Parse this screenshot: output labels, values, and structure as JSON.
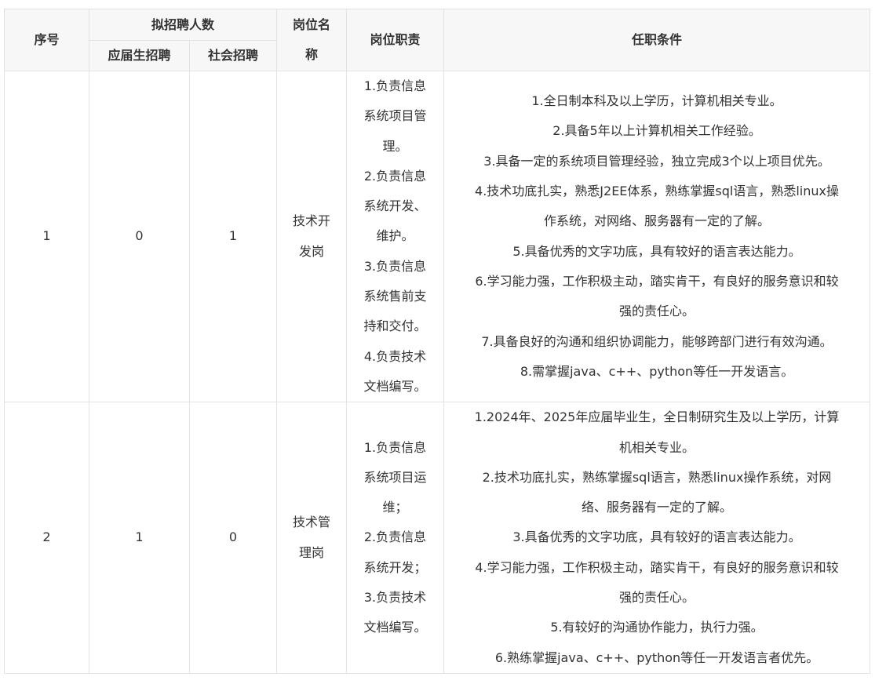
{
  "headers": {
    "seq": "序号",
    "plan_count": "拟招聘人数",
    "fresh": "应届生招聘",
    "social": "社会招聘",
    "position_name_lines": [
      "岗位名",
      "称"
    ],
    "duties": "岗位职责",
    "requirements": "任职条件"
  },
  "rows": [
    {
      "seq": "1",
      "fresh": "0",
      "social": "1",
      "position_lines": [
        "技术开",
        "发岗"
      ],
      "duties_lines": [
        "1.负责信息",
        "系统项目管",
        "理。",
        "2.负责信息",
        "系统开发、",
        "维护。",
        "3.负责信息",
        "系统售前支",
        "持和交付。",
        "4.负责技术",
        "文档编写。"
      ],
      "requirements_lines": [
        "1.全日制本科及以上学历，计算机相关专业。",
        "2.具备5年以上计算机相关工作经验。",
        "3.具备一定的系统项目管理经验，独立完成3个以上项目优先。",
        "4.技术功底扎实，熟悉J2EE体系，熟练掌握sql语言，熟悉linux操",
        "作系统，对网络、服务器有一定的了解。",
        "5.具备优秀的文字功底，具有较好的语言表达能力。",
        "6.学习能力强，工作积极主动，踏实肯干，有良好的服务意识和较",
        "强的责任心。",
        "7.具备良好的沟通和组织协调能力，能够跨部门进行有效沟通。",
        "8.需掌握java、c++、python等任一开发语言。"
      ]
    },
    {
      "seq": "2",
      "fresh": "1",
      "social": "0",
      "position_lines": [
        "技术管",
        "理岗"
      ],
      "duties_lines": [
        "1.负责信息",
        "系统项目运",
        "维；",
        "2.负责信息",
        "系统开发；",
        "3.负责技术",
        "文档编写。"
      ],
      "requirements_lines": [
        "1.2024年、2025年应届毕业生，全日制研究生及以上学历，计算",
        "机相关专业。",
        "2.技术功底扎实，熟练掌握sql语言，熟悉linux操作系统，对网",
        "络、服务器有一定的了解。",
        "3.具备优秀的文字功底，具有较好的语言表达能力。",
        "4.学习能力强，工作积极主动，踏实肯干，有良好的服务意识和较",
        "强的责任心。",
        "5.有较好的沟通协作能力，执行力强。",
        "6.熟练掌握java、c++、python等任一开发语言者优先。"
      ]
    }
  ]
}
